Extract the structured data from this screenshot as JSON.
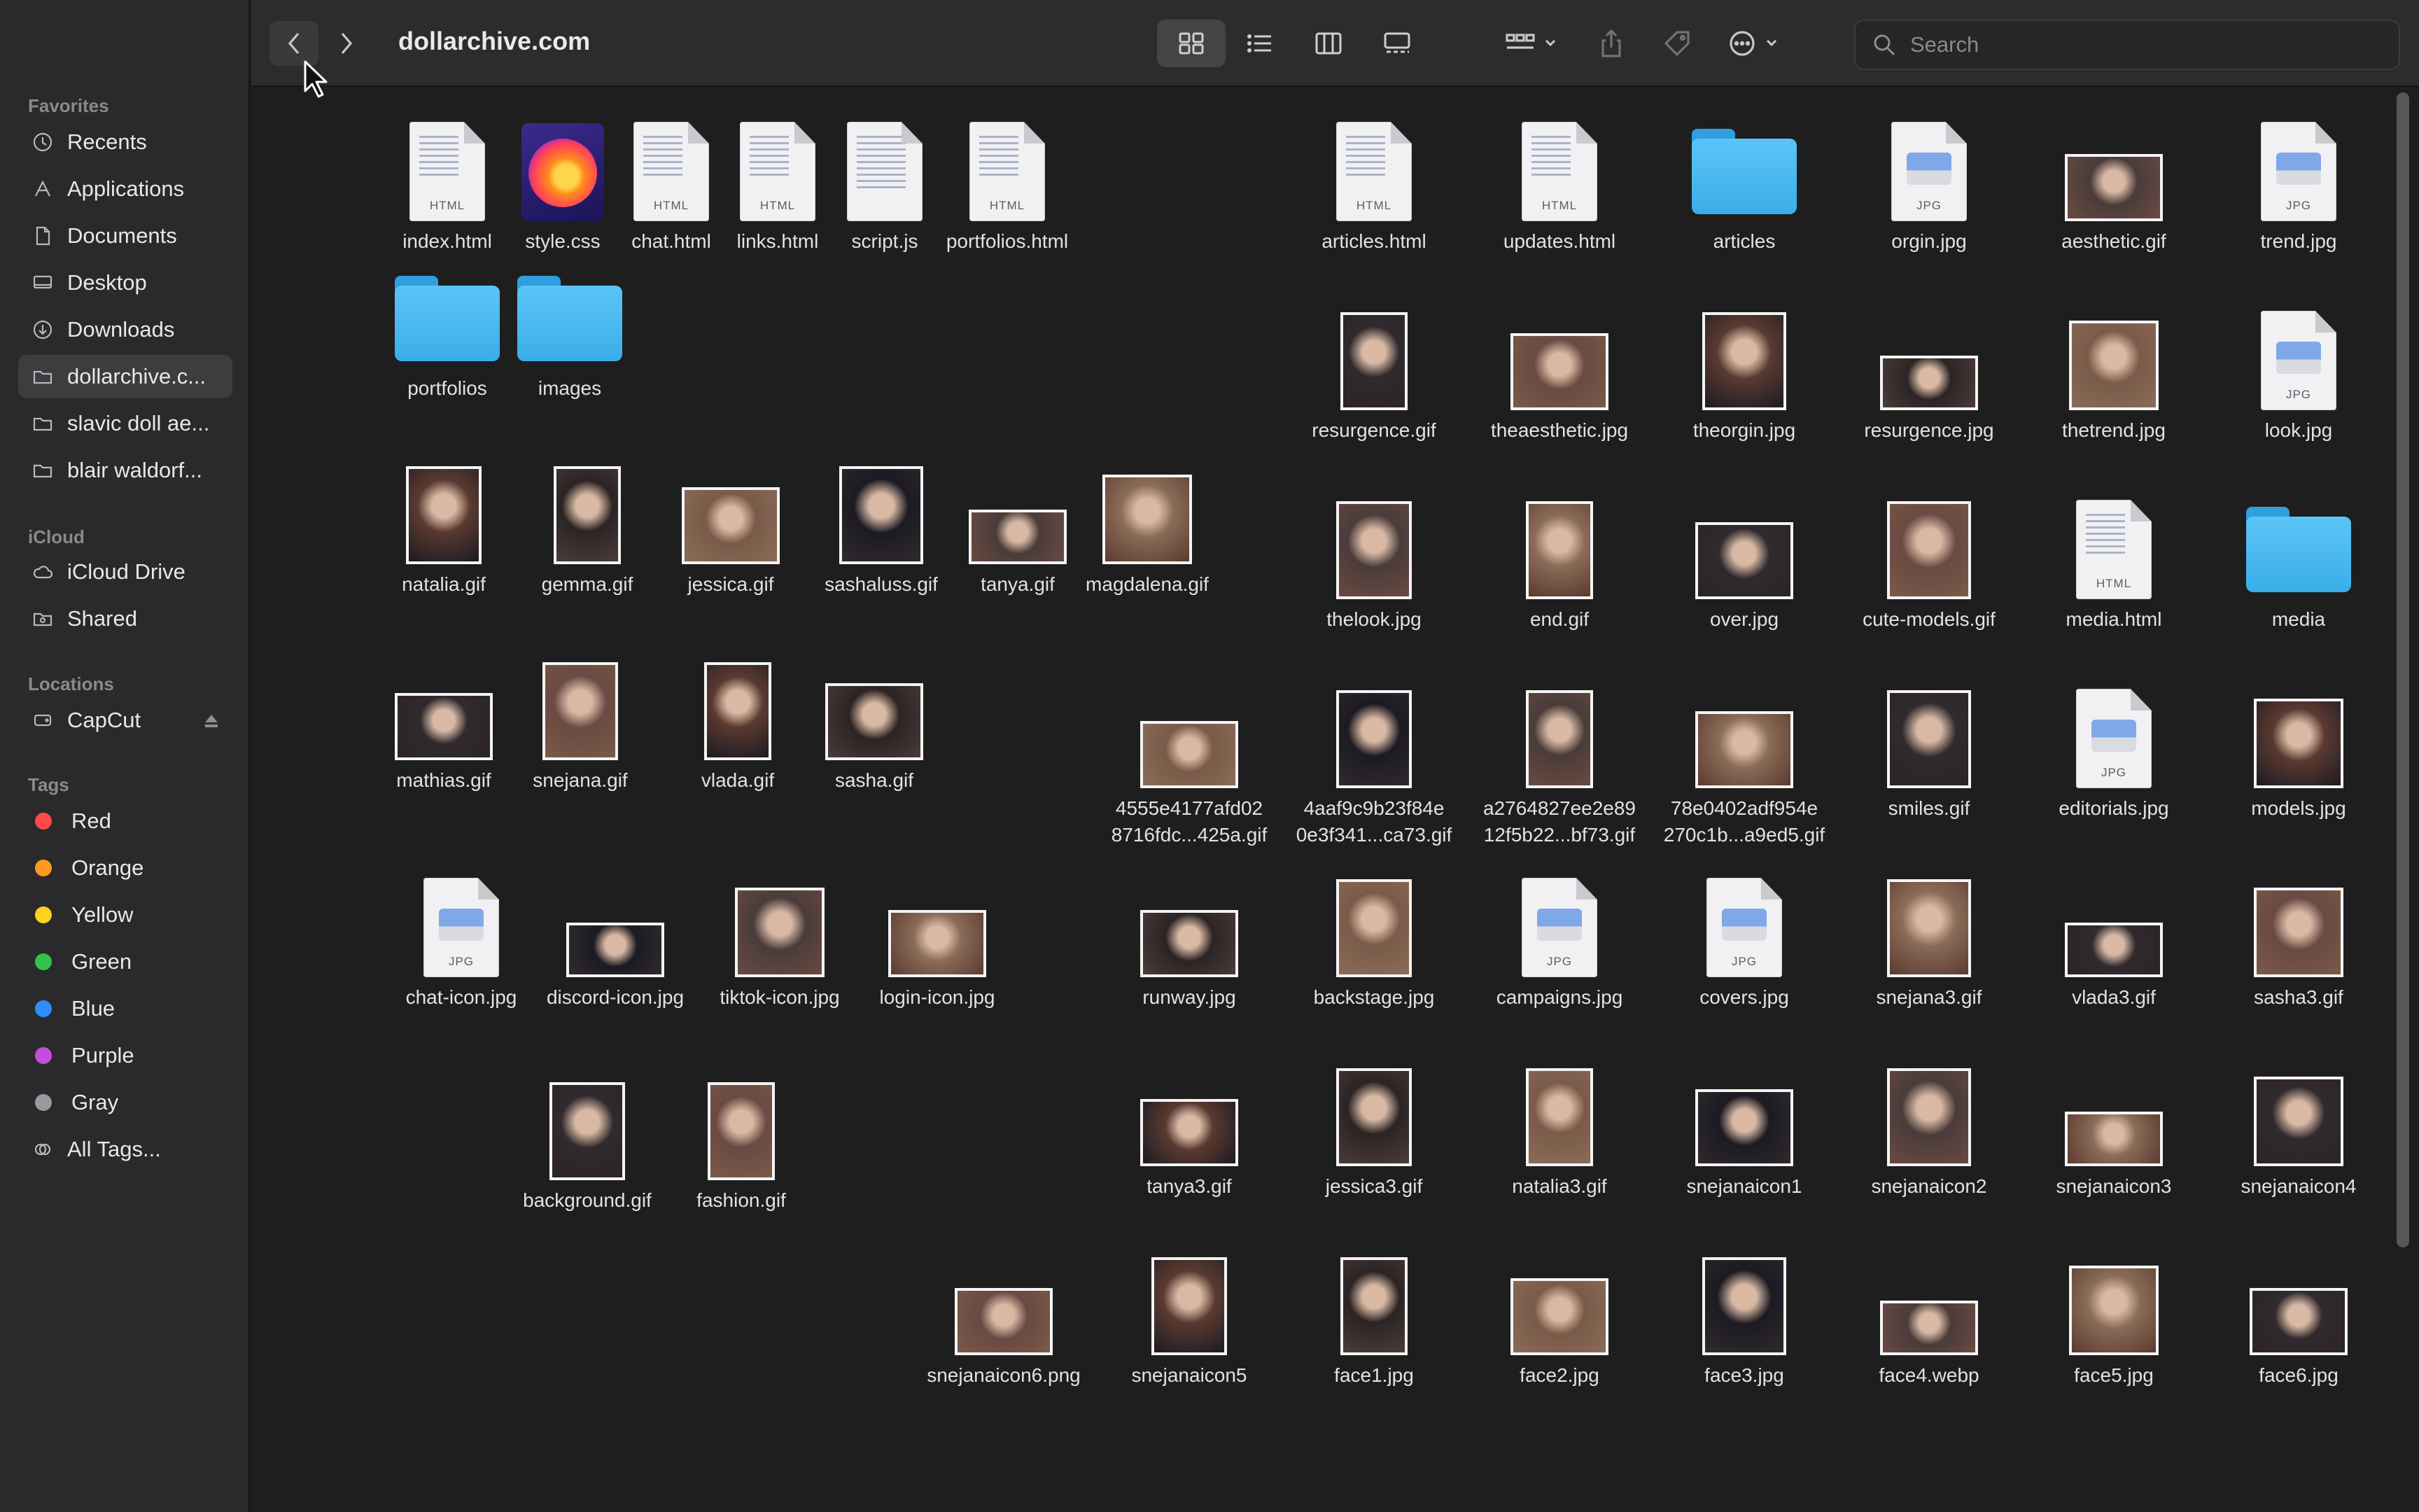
{
  "window": {
    "title": "dollarchive.com"
  },
  "toolbar": {
    "back_label": "back",
    "forward_label": "forward",
    "views": [
      "icon-view",
      "list-view",
      "column-view",
      "gallery-view"
    ],
    "search_placeholder": "Search"
  },
  "sidebar": {
    "favorites_title": "Favorites",
    "favorites": [
      {
        "label": "Recents",
        "icon": "clock-icon"
      },
      {
        "label": "Applications",
        "icon": "applications-icon"
      },
      {
        "label": "Documents",
        "icon": "document-icon"
      },
      {
        "label": "Desktop",
        "icon": "desktop-icon"
      },
      {
        "label": "Downloads",
        "icon": "download-icon"
      },
      {
        "label": "dollarchive.c...",
        "icon": "folder-icon",
        "selected": true
      },
      {
        "label": "slavic doll ae...",
        "icon": "folder-icon"
      },
      {
        "label": "blair waldorf...",
        "icon": "folder-icon"
      }
    ],
    "icloud_title": "iCloud",
    "icloud": [
      {
        "label": "iCloud Drive",
        "icon": "cloud-icon"
      },
      {
        "label": "Shared",
        "icon": "shared-folder-icon"
      }
    ],
    "locations_title": "Locations",
    "locations": [
      {
        "label": "CapCut",
        "icon": "disk-icon"
      }
    ],
    "tags_title": "Tags",
    "tags": [
      {
        "label": "Red",
        "color": "#ff4a4a"
      },
      {
        "label": "Orange",
        "color": "#ff9a1f"
      },
      {
        "label": "Yellow",
        "color": "#ffd21f"
      },
      {
        "label": "Green",
        "color": "#33c24d"
      },
      {
        "label": "Blue",
        "color": "#2f8cff"
      },
      {
        "label": "Purple",
        "color": "#c44de0"
      },
      {
        "label": "Gray",
        "color": "#9a9a9e"
      },
      {
        "label": "All Tags...",
        "color": ""
      }
    ]
  },
  "files": [
    {
      "name": "index.html",
      "kind": "html"
    },
    {
      "name": "style.css",
      "kind": "firefox"
    },
    {
      "name": "chat.html",
      "kind": "html"
    },
    {
      "name": "links.html",
      "kind": "html"
    },
    {
      "name": "script.js",
      "kind": "text"
    },
    {
      "name": "portfolios.html",
      "kind": "html"
    },
    {
      "name": "portfolios",
      "kind": "folder"
    },
    {
      "name": "images",
      "kind": "folder"
    },
    {
      "name": "natalia.gif",
      "kind": "photo"
    },
    {
      "name": "gemma.gif",
      "kind": "photo"
    },
    {
      "name": "jessica.gif",
      "kind": "photo"
    },
    {
      "name": "sashaluss.gif",
      "kind": "photo"
    },
    {
      "name": "tanya.gif",
      "kind": "photo"
    },
    {
      "name": "magdalena.gif",
      "kind": "photo"
    },
    {
      "name": "mathias.gif",
      "kind": "photo"
    },
    {
      "name": "snejana.gif",
      "kind": "photo"
    },
    {
      "name": "vlada.gif",
      "kind": "photo"
    },
    {
      "name": "sasha.gif",
      "kind": "photo"
    },
    {
      "name": "chat-icon.jpg",
      "kind": "jpg"
    },
    {
      "name": "discord-icon.jpg",
      "kind": "photo"
    },
    {
      "name": "tiktok-icon.jpg",
      "kind": "photo"
    },
    {
      "name": "login-icon.jpg",
      "kind": "photo"
    },
    {
      "name": "background.gif",
      "kind": "photo"
    },
    {
      "name": "fashion.gif",
      "kind": "photo"
    },
    {
      "name": "articles.html",
      "kind": "html"
    },
    {
      "name": "updates.html",
      "kind": "html"
    },
    {
      "name": "articles",
      "kind": "folder"
    },
    {
      "name": "orgin.jpg",
      "kind": "jpg"
    },
    {
      "name": "aesthetic.gif",
      "kind": "photo"
    },
    {
      "name": "trend.jpg",
      "kind": "jpg"
    },
    {
      "name": "resurgence.gif",
      "kind": "photo"
    },
    {
      "name": "theaesthetic.jpg",
      "kind": "photo"
    },
    {
      "name": "theorgin.jpg",
      "kind": "photo"
    },
    {
      "name": "resurgence.jpg",
      "kind": "photo"
    },
    {
      "name": "thetrend.jpg",
      "kind": "photo"
    },
    {
      "name": "look.jpg",
      "kind": "jpg"
    },
    {
      "name": "thelook.jpg",
      "kind": "photo"
    },
    {
      "name": "end.gif",
      "kind": "photo"
    },
    {
      "name": "over.jpg",
      "kind": "photo"
    },
    {
      "name": "cute-models.gif",
      "kind": "photo"
    },
    {
      "name": "media.html",
      "kind": "html"
    },
    {
      "name": "media",
      "kind": "folder"
    },
    {
      "name": "4555e4177afd02\n8716fdc...425a.gif",
      "kind": "photo"
    },
    {
      "name": "4aaf9c9b23f84e\n0e3f341...ca73.gif",
      "kind": "photo"
    },
    {
      "name": "a2764827ee2e89\n12f5b22...bf73.gif",
      "kind": "photo"
    },
    {
      "name": "78e0402adf954e\n270c1b...a9ed5.gif",
      "kind": "photo"
    },
    {
      "name": "smiles.gif",
      "kind": "photo"
    },
    {
      "name": "editorials.jpg",
      "kind": "jpg"
    },
    {
      "name": "models.jpg",
      "kind": "photo"
    },
    {
      "name": "runway.jpg",
      "kind": "photo"
    },
    {
      "name": "backstage.jpg",
      "kind": "photo"
    },
    {
      "name": "campaigns.jpg",
      "kind": "jpg"
    },
    {
      "name": "covers.jpg",
      "kind": "jpg"
    },
    {
      "name": "snejana3.gif",
      "kind": "photo"
    },
    {
      "name": "vlada3.gif",
      "kind": "photo"
    },
    {
      "name": "sasha3.gif",
      "kind": "photo"
    },
    {
      "name": "tanya3.gif",
      "kind": "photo"
    },
    {
      "name": "jessica3.gif",
      "kind": "photo"
    },
    {
      "name": "natalia3.gif",
      "kind": "photo"
    },
    {
      "name": "snejanaicon1",
      "kind": "photo"
    },
    {
      "name": "snejanaicon2",
      "kind": "photo"
    },
    {
      "name": "snejanaicon3",
      "kind": "photo"
    },
    {
      "name": "snejanaicon4",
      "kind": "photo"
    },
    {
      "name": "snejanaicon6.png",
      "kind": "photo"
    },
    {
      "name": "snejanaicon5",
      "kind": "photo"
    },
    {
      "name": "face1.jpg",
      "kind": "photo"
    },
    {
      "name": "face2.jpg",
      "kind": "photo"
    },
    {
      "name": "face3.jpg",
      "kind": "photo"
    },
    {
      "name": "face4.webp",
      "kind": "photo"
    },
    {
      "name": "face5.jpg",
      "kind": "photo"
    },
    {
      "name": "face6.jpg",
      "kind": "photo"
    }
  ]
}
